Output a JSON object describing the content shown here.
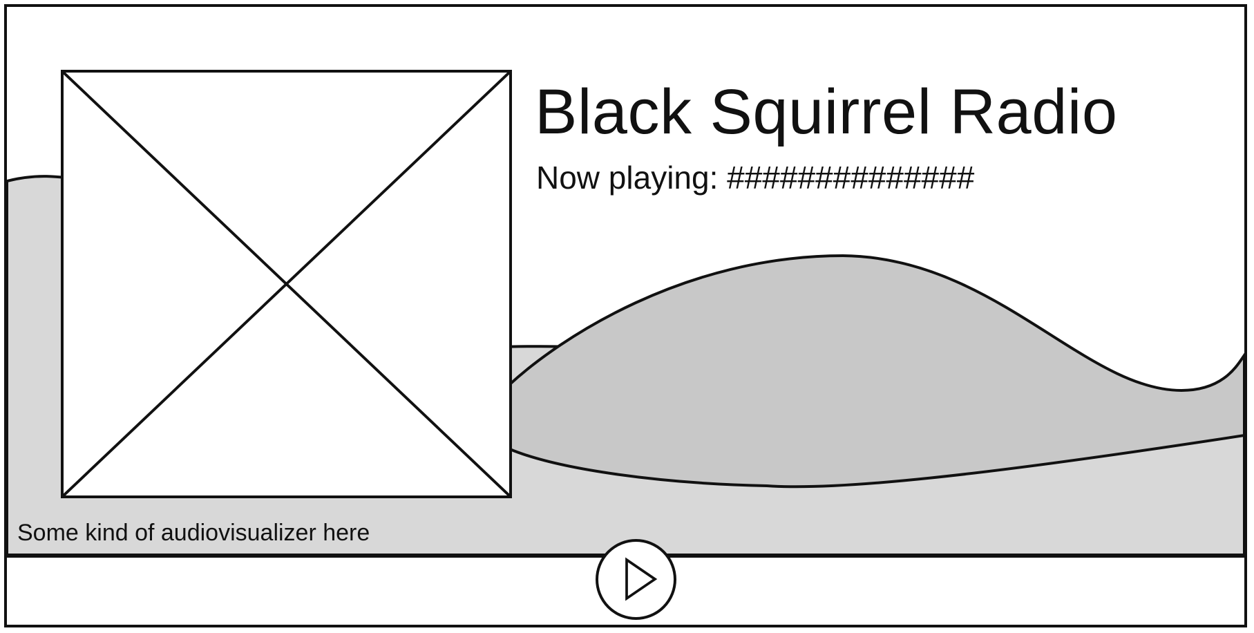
{
  "station": {
    "title": "Black Squirrel Radio",
    "now_playing": "Now playing: ##############"
  },
  "visualizer": {
    "caption": "Some kind of audiovisualizer here"
  },
  "controls": {
    "play_icon": "play-icon"
  },
  "colors": {
    "outline": "#111111",
    "wave_light": "#d8d8d8",
    "wave_dark": "#c8c8c8",
    "background": "#ffffff"
  }
}
